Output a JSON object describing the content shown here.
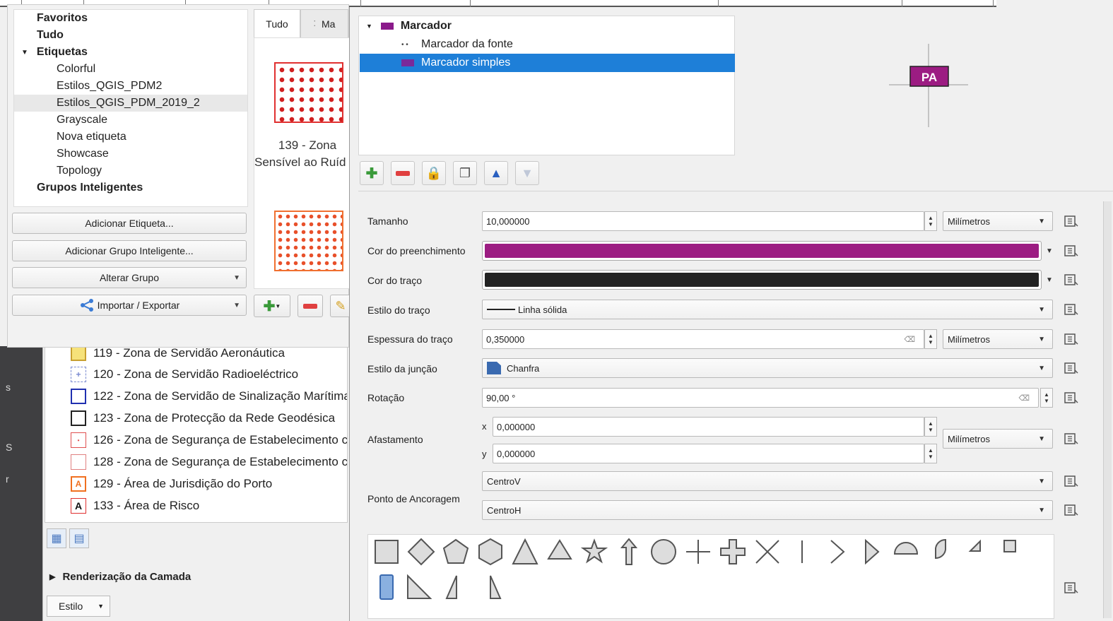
{
  "style_manager": {
    "tag_tree": [
      {
        "label": "Favoritos",
        "bold": true
      },
      {
        "label": "Tudo",
        "bold": true
      },
      {
        "label": "Etiquetas",
        "bold": true
      },
      {
        "label": "Colorful"
      },
      {
        "label": "Estilos_QGIS_PDM2"
      },
      {
        "label": "Estilos_QGIS_PDM_2019_2"
      },
      {
        "label": "Grayscale"
      },
      {
        "label": "Nova etiqueta"
      },
      {
        "label": "Showcase"
      },
      {
        "label": "Topology"
      },
      {
        "label": "Grupos Inteligentes",
        "bold": true
      }
    ],
    "buttons": {
      "add_tag": "Adicionar Etiqueta...",
      "add_smart_group": "Adicionar Grupo Inteligente...",
      "modify_group": "Alterar Grupo",
      "import_export": "Importar / Exportar"
    },
    "tabs": {
      "all": "Tudo",
      "markers": "Ma"
    },
    "symbol_label_line1": "139 - Zona",
    "symbol_label_line2": "Sensível ao Ruíd"
  },
  "layer_list": {
    "rows": [
      {
        "label": "119 - Zona de Servidão Aeronáutica",
        "icon_color": "#e8c040"
      },
      {
        "label": "120 - Zona de Servidão Radioeléctrico",
        "icon_color": "#7a8ad0"
      },
      {
        "label": "122 - Zona de Servidão de Sinalização Marítima",
        "icon_color": "#2030b0"
      },
      {
        "label": "123 - Zona de Protecção da Rede Geodésica",
        "icon_color": "#222222"
      },
      {
        "label": "126 - Zona de Segurança de Estabelecimento c",
        "icon_color": "#e05050"
      },
      {
        "label": "128 - Zona de Segurança de Estabelecimento c",
        "icon_color": "#e08080"
      },
      {
        "label": "129 - Área de Jurisdição do Porto",
        "icon_color": "#f07020",
        "glyph": "A"
      },
      {
        "label": "133 - Área de Risco",
        "icon_color": "#e03030",
        "glyph": "A"
      }
    ],
    "render_section": "Renderização da Camada",
    "style_combo": "Estilo",
    "left_fragments": [
      "s",
      "S",
      "r"
    ]
  },
  "symbol_selector": {
    "symbol_layers": [
      {
        "label": "Marcador"
      },
      {
        "label": "Marcador da fonte"
      },
      {
        "label": "Marcador simples"
      }
    ],
    "preview_text": "PA",
    "properties": {
      "size_label": "Tamanho",
      "size_value": "10,000000",
      "size_unit": "Milímetros",
      "fill_color_label": "Cor do preenchimento",
      "fill_color": "#9c1c82",
      "stroke_color_label": "Cor do traço",
      "stroke_color": "#222222",
      "stroke_style_label": "Estilo do traço",
      "stroke_style_value": "Linha sólida",
      "stroke_width_label": "Espessura do traço",
      "stroke_width_value": "0,350000",
      "stroke_width_unit": "Milímetros",
      "join_style_label": "Estilo da junção",
      "join_style_value": "Chanfra",
      "rotation_label": "Rotação",
      "rotation_value": "90,00 °",
      "offset_label": "Afastamento",
      "offset_x_label": "x",
      "offset_x_value": "0,000000",
      "offset_y_label": "y",
      "offset_y_value": "0,000000",
      "offset_unit": "Milímetros",
      "anchor_label": "Ponto de Ancoragem",
      "anchor_v_value": "CentroV",
      "anchor_h_value": "CentroH"
    },
    "accent_selected": "#1e7fd8"
  }
}
